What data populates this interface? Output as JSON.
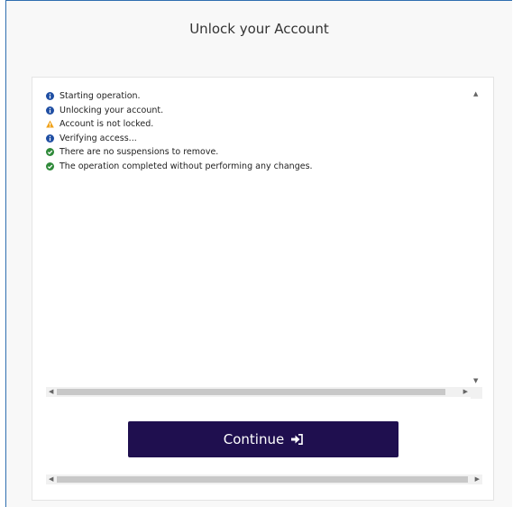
{
  "window": {
    "title": "Unlock your Account"
  },
  "log": [
    {
      "status": "info",
      "icon": "info-icon",
      "text": "Starting operation."
    },
    {
      "status": "info",
      "icon": "info-icon",
      "text": "Unlocking your account."
    },
    {
      "status": "warning",
      "icon": "warning-icon",
      "text": "Account is not locked."
    },
    {
      "status": "info",
      "icon": "info-icon",
      "text": "Verifying access..."
    },
    {
      "status": "success",
      "icon": "check-icon",
      "text": "There are no suspensions to remove."
    },
    {
      "status": "success",
      "icon": "check-icon",
      "text": "The operation completed without performing any changes."
    }
  ],
  "colors": {
    "info": "#1f4ea3",
    "warning": "#f0a21a",
    "success": "#2f8a3a",
    "button": "#1f0f4f"
  },
  "actions": {
    "continue_label": "Continue",
    "continue_icon": "sign-in-icon"
  }
}
